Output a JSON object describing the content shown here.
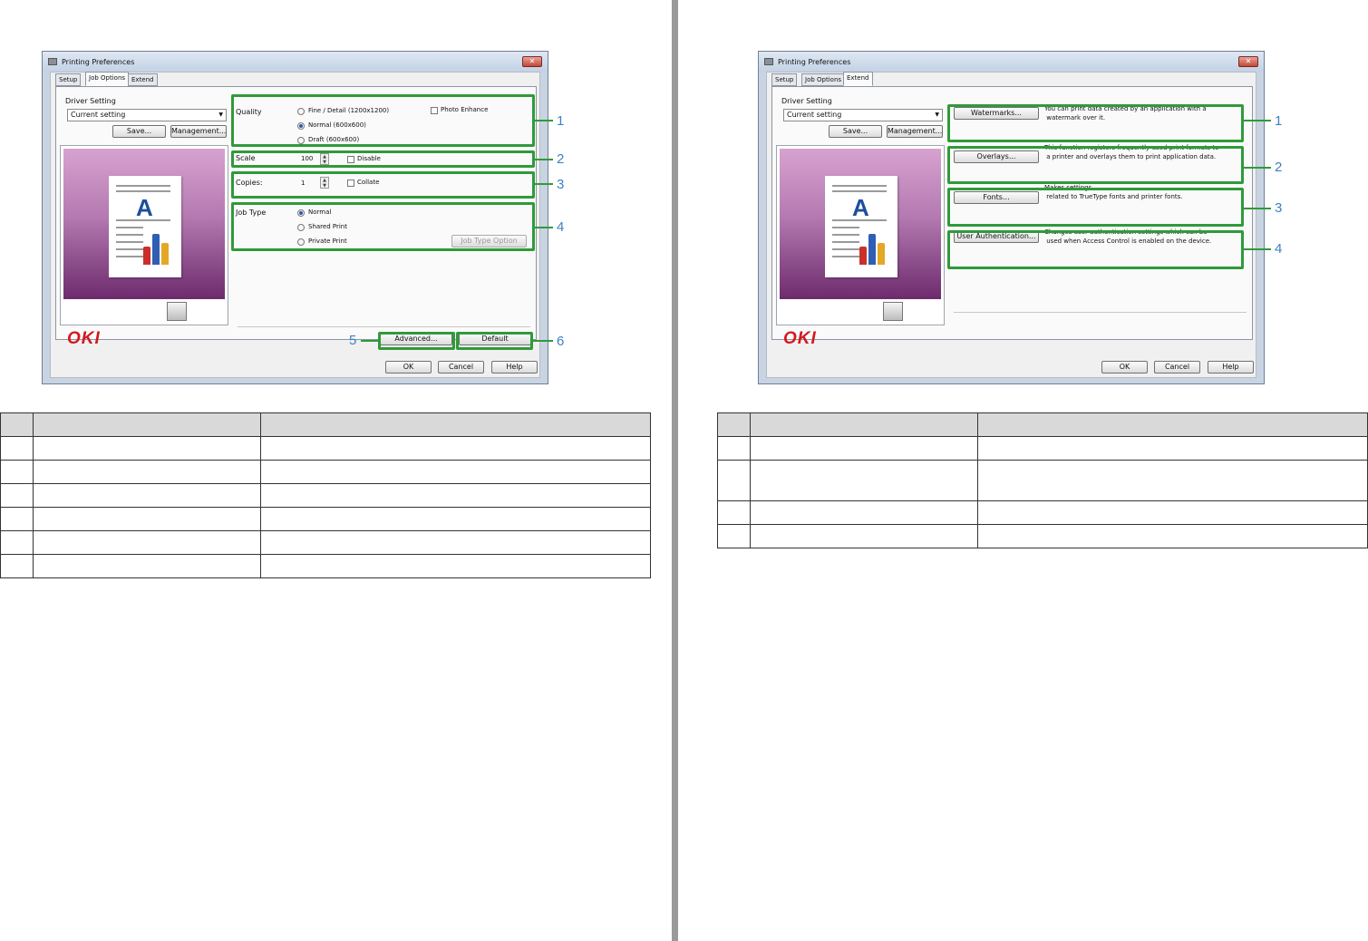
{
  "left": {
    "window_title": "Printing Preferences",
    "tabs": [
      "Setup",
      "Job Options",
      "Extend"
    ],
    "driver_setting": {
      "label": "Driver Setting",
      "value": "Current setting",
      "save": "Save...",
      "management": "Management..."
    },
    "quality": {
      "label": "Quality",
      "options": [
        "Fine / Detail (1200x1200)",
        "Normal (600x600)",
        "Draft (600x600)"
      ],
      "photo_enhance": "Photo Enhance"
    },
    "scale": {
      "label": "Scale",
      "value": "100",
      "disable": "Disable"
    },
    "copies": {
      "label": "Copies:",
      "value": "1",
      "collate": "Collate"
    },
    "job_type": {
      "label": "Job Type",
      "options": [
        "Normal",
        "Shared Print",
        "Private Print"
      ],
      "option_button": "Job Type Option"
    },
    "advanced_button": "Advanced...",
    "default_button": "Default",
    "brand": "OKI",
    "ok": "OK",
    "cancel": "Cancel",
    "help": "Help",
    "callouts": [
      "1",
      "2",
      "3",
      "4",
      "5",
      "6"
    ]
  },
  "right": {
    "window_title": "Printing Preferences",
    "tabs": [
      "Setup",
      "Job Options",
      "Extend"
    ],
    "driver_setting": {
      "label": "Driver Setting",
      "value": "Current setting",
      "save": "Save...",
      "management": "Management..."
    },
    "items": [
      {
        "button": "Watermarks...",
        "desc1": "You can print data created by an application with a",
        "desc2": "watermark over it."
      },
      {
        "button": "Overlays...",
        "desc1": "This function registers frequently-used print formats to",
        "desc2": "a printer and overlays them to print application data."
      },
      {
        "button": "Fonts...",
        "desc1": "Makes settings",
        "desc2": "related to TrueType fonts and printer fonts."
      },
      {
        "button": "User Authentication...",
        "desc1": "Changes user authentication settings which can be",
        "desc2": "used when Access Control is enabled on the device."
      }
    ],
    "brand": "OKI",
    "ok": "OK",
    "cancel": "Cancel",
    "help": "Help",
    "callouts": [
      "1",
      "2",
      "3",
      "4"
    ]
  }
}
